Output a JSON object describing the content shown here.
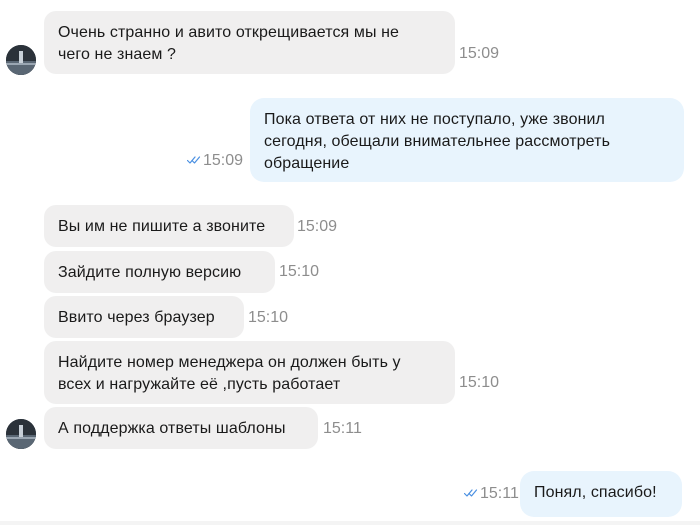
{
  "messages": [
    {
      "text_lines": [
        "Очень странно и авито открещивается мы не",
        "чего не знаем ?"
      ],
      "time": "15:09"
    },
    {
      "text_lines": [
        "Пока ответа от них не поступало, уже звонил",
        "сегодня, обещали внимательнее рассмотреть",
        "обращение"
      ],
      "time": "15:09"
    },
    {
      "text_lines": [
        "Вы им не пишите а звоните"
      ],
      "time": "15:09"
    },
    {
      "text_lines": [
        "Зайдите полную версию"
      ],
      "time": "15:10"
    },
    {
      "text_lines": [
        "Ввито через браузер"
      ],
      "time": "15:10"
    },
    {
      "text_lines": [
        "Найдите номер менеджера он должен быть у",
        "всех и нагружайте её ,пусть работает"
      ],
      "time": "15:10"
    },
    {
      "text_lines": [
        "А поддержка ответы шаблоны"
      ],
      "time": "15:11"
    },
    {
      "text_lines": [
        "Понял, спасибо!"
      ],
      "time": "15:11"
    }
  ],
  "icons": {
    "avatar": "avatar-photo",
    "read_receipt": "double-check-icon"
  },
  "colors": {
    "incoming_bubble": "#f0efef",
    "outgoing_bubble": "#e8f4fd",
    "check": "#4a90e2",
    "time": "#8d8d8d"
  }
}
